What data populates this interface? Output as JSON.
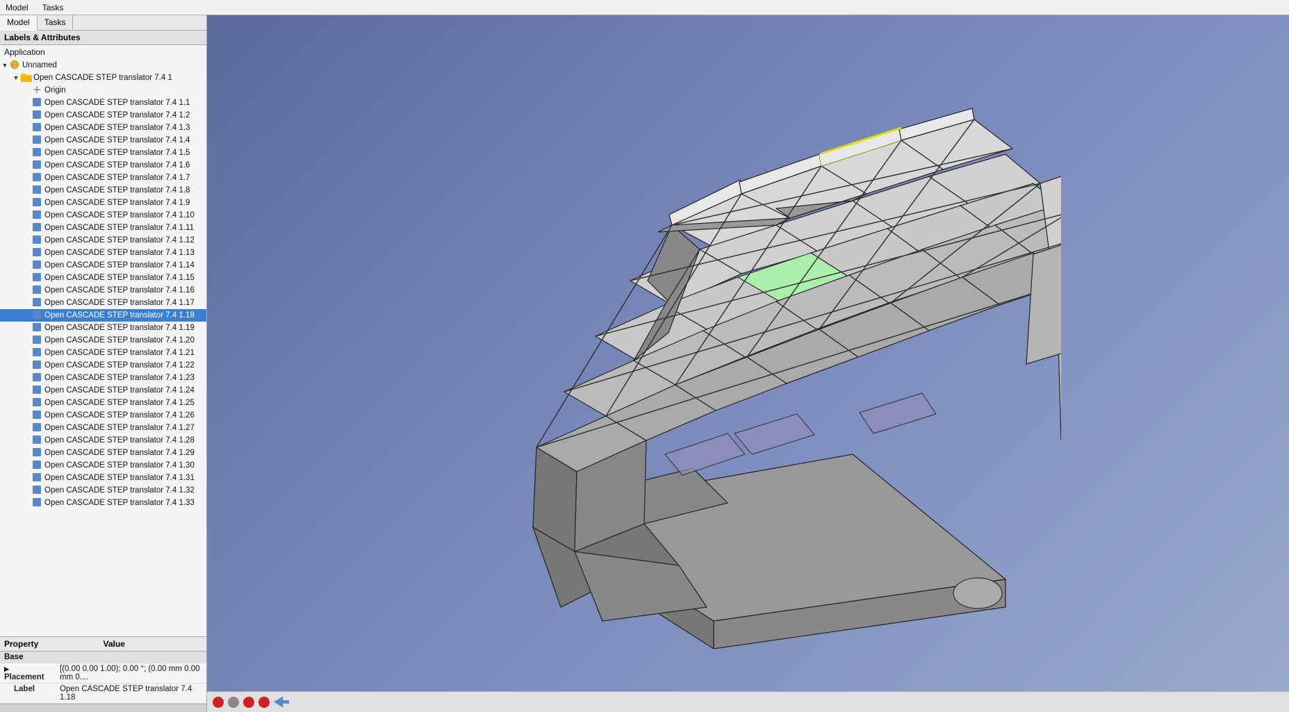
{
  "menubar": {
    "items": [
      "Model",
      "Tasks"
    ]
  },
  "left_panel": {
    "tabs": [
      {
        "label": "Model",
        "active": true
      },
      {
        "label": "Tasks",
        "active": false
      }
    ],
    "labels_header": "Labels & Attributes",
    "app_label": "Application",
    "tree": {
      "root": {
        "label": "Unnamed",
        "icon": "globe",
        "expanded": true,
        "children": [
          {
            "label": "Open CASCADE STEP translator 7.4 1",
            "icon": "folder",
            "expanded": true,
            "children": [
              {
                "label": "Origin",
                "icon": "origin",
                "expanded": false,
                "children": []
              },
              {
                "label": "Open CASCADE STEP translator 7.4 1.1",
                "icon": "shape"
              },
              {
                "label": "Open CASCADE STEP translator 7.4 1.2",
                "icon": "shape"
              },
              {
                "label": "Open CASCADE STEP translator 7.4 1.3",
                "icon": "shape"
              },
              {
                "label": "Open CASCADE STEP translator 7.4 1.4",
                "icon": "shape"
              },
              {
                "label": "Open CASCADE STEP translator 7.4 1.5",
                "icon": "shape"
              },
              {
                "label": "Open CASCADE STEP translator 7.4 1.6",
                "icon": "shape"
              },
              {
                "label": "Open CASCADE STEP translator 7.4 1.7",
                "icon": "shape"
              },
              {
                "label": "Open CASCADE STEP translator 7.4 1.8",
                "icon": "shape"
              },
              {
                "label": "Open CASCADE STEP translator 7.4 1.9",
                "icon": "shape"
              },
              {
                "label": "Open CASCADE STEP translator 7.4 1.10",
                "icon": "shape"
              },
              {
                "label": "Open CASCADE STEP translator 7.4 1.11",
                "icon": "shape"
              },
              {
                "label": "Open CASCADE STEP translator 7.4 1.12",
                "icon": "shape"
              },
              {
                "label": "Open CASCADE STEP translator 7.4 1.13",
                "icon": "shape"
              },
              {
                "label": "Open CASCADE STEP translator 7.4 1.14",
                "icon": "shape"
              },
              {
                "label": "Open CASCADE STEP translator 7.4 1.15",
                "icon": "shape"
              },
              {
                "label": "Open CASCADE STEP translator 7.4 1.16",
                "icon": "shape"
              },
              {
                "label": "Open CASCADE STEP translator 7.4 1.17",
                "icon": "shape"
              },
              {
                "label": "Open CASCADE STEP translator 7.4 1.18",
                "icon": "shape",
                "selected": true
              },
              {
                "label": "Open CASCADE STEP translator 7.4 1.19",
                "icon": "shape"
              },
              {
                "label": "Open CASCADE STEP translator 7.4 1.20",
                "icon": "shape"
              },
              {
                "label": "Open CASCADE STEP translator 7.4 1.21",
                "icon": "shape"
              },
              {
                "label": "Open CASCADE STEP translator 7.4 1.22",
                "icon": "shape"
              },
              {
                "label": "Open CASCADE STEP translator 7.4 1.23",
                "icon": "shape"
              },
              {
                "label": "Open CASCADE STEP translator 7.4 1.24",
                "icon": "shape"
              },
              {
                "label": "Open CASCADE STEP translator 7.4 1.25",
                "icon": "shape"
              },
              {
                "label": "Open CASCADE STEP translator 7.4 1.26",
                "icon": "shape"
              },
              {
                "label": "Open CASCADE STEP translator 7.4 1.27",
                "icon": "shape"
              },
              {
                "label": "Open CASCADE STEP translator 7.4 1.28",
                "icon": "shape"
              },
              {
                "label": "Open CASCADE STEP translator 7.4 1.29",
                "icon": "shape"
              },
              {
                "label": "Open CASCADE STEP translator 7.4 1.30",
                "icon": "shape"
              },
              {
                "label": "Open CASCADE STEP translator 7.4 1.31",
                "icon": "shape"
              },
              {
                "label": "Open CASCADE STEP translator 7.4 1.32",
                "icon": "shape"
              },
              {
                "label": "Open CASCADE STEP translator 7.4 1.33",
                "icon": "shape"
              }
            ]
          }
        ]
      }
    },
    "properties": {
      "header_property": "Property",
      "header_value": "Value",
      "group_base": "Base",
      "rows": [
        {
          "property": "Placement",
          "value": "[(0.00 0.00 1.00); 0.00 °; (0.00 mm  0.00 mm  0....",
          "expandable": true
        },
        {
          "property": "Label",
          "value": "Open CASCADE STEP translator 7.4 1.18"
        }
      ]
    }
  },
  "viewport": {
    "background_color_start": "#5a6a9a",
    "background_color_end": "#9aabcc"
  },
  "status_bar": {
    "text": ""
  },
  "bottom_toolbar": {
    "buttons": [
      "red-circle",
      "red-circle-2",
      "red-circle-3",
      "arrow-icon"
    ]
  }
}
